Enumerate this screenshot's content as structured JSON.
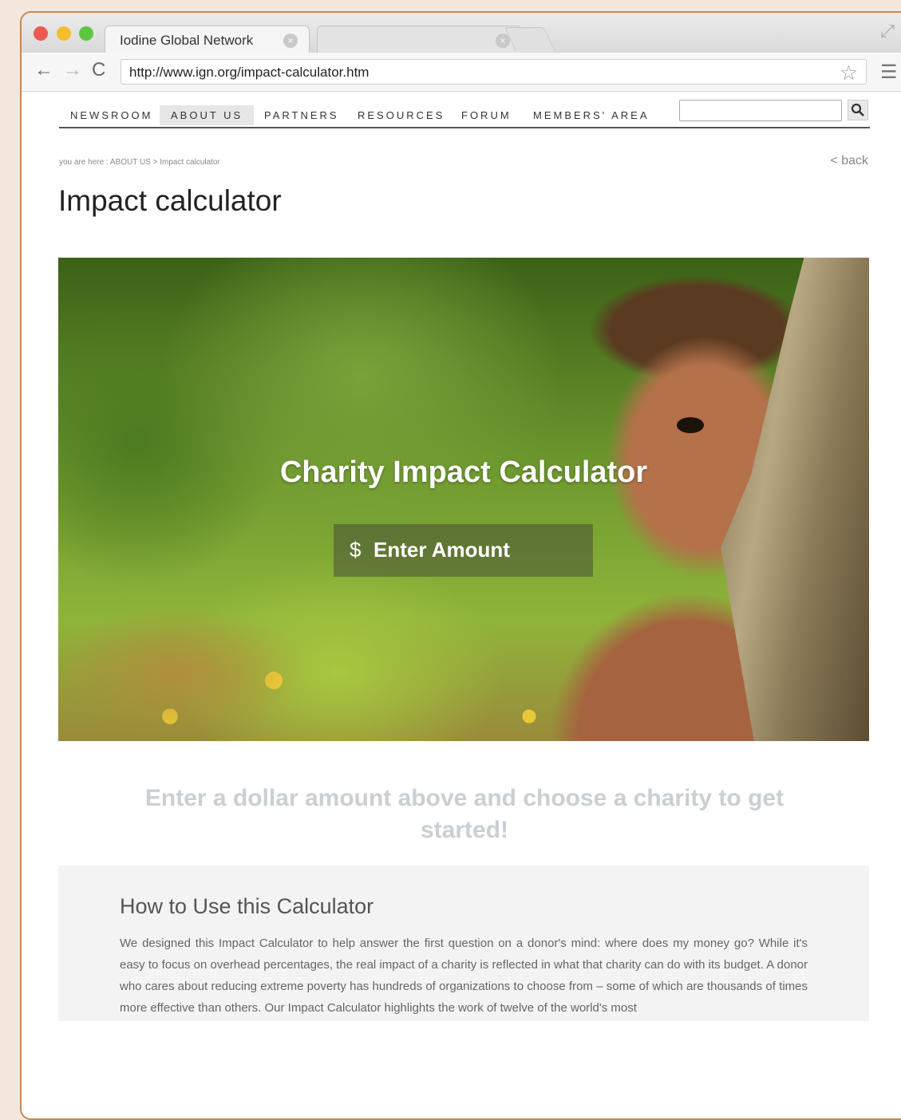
{
  "browser": {
    "tab_title": "Iodine Global Network",
    "tab_close": "×",
    "url": "http://www.ign.org/impact-calculator.htm"
  },
  "icons": {
    "back": "←",
    "forward": "→",
    "reload": "C",
    "star": "☆",
    "menu": "☰",
    "expand": "⤢",
    "search": "⌕"
  },
  "nav": {
    "items": [
      "NEWSROOM",
      "ABOUT US",
      "PARTNERS",
      "RESOURCES",
      "FORUM",
      "MEMBERS' AREA"
    ],
    "active": "ABOUT US",
    "search_value": ""
  },
  "breadcrumb": "you are here : ABOUT US > Impact calculator",
  "back_link": "< back",
  "page_title": "Impact calculator",
  "hero": {
    "title": "Charity Impact Calculator",
    "currency": "$",
    "amount_placeholder": "Enter Amount"
  },
  "prompt": "Enter a dollar amount above and choose a charity to get started!",
  "howto": {
    "title": "How to Use this Calculator",
    "text": "We designed this Impact Calculator to help answer the first question on a donor's mind: where does my money go? While it's easy to focus on overhead percentages, the real impact of a charity is reflected in what that charity can do with its budget. A donor who cares about reducing extreme poverty has hundreds of organizations to choose from – some of which are thousands of times more effective than others. Our Impact Calculator highlights the work of twelve of the world's most"
  }
}
